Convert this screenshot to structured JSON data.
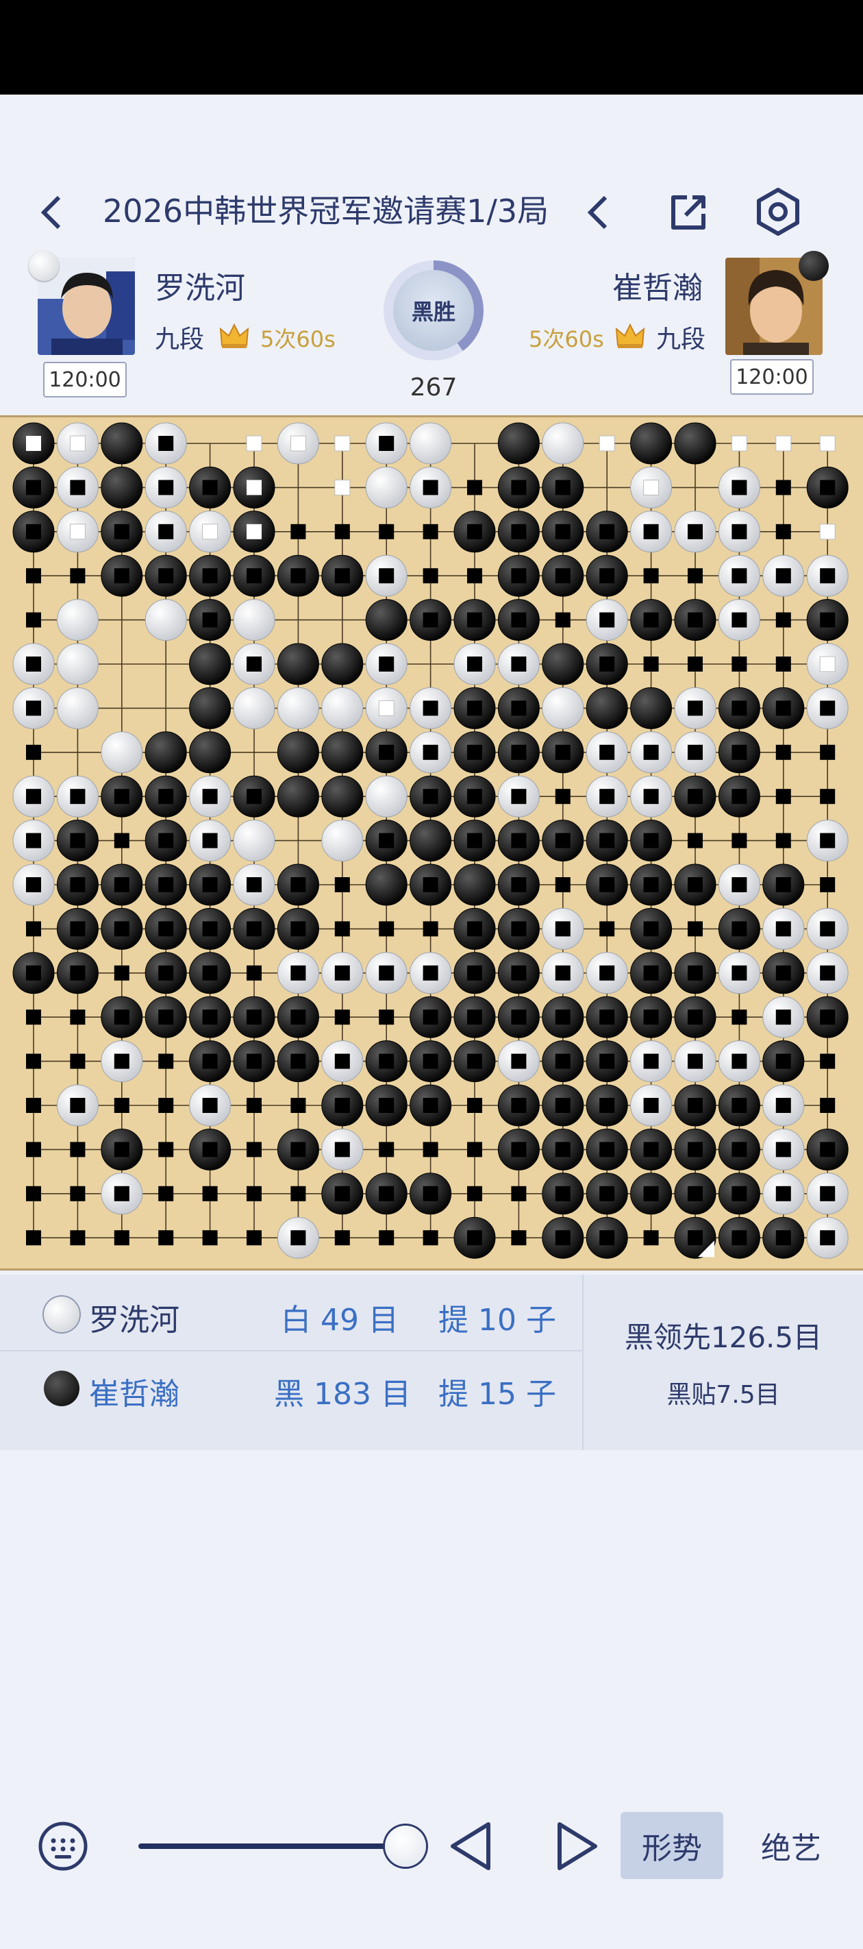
{
  "header": {
    "title": "2026中韩世界冠军邀请赛1/3局"
  },
  "players": {
    "white": {
      "name": "罗洗河",
      "rank": "九段",
      "info": "5次60s",
      "time": "120:00"
    },
    "black": {
      "name": "崔哲瀚",
      "rank": "九段",
      "info": "5次60s",
      "time": "120:00"
    }
  },
  "result": {
    "label": "黑胜",
    "move_count": "267"
  },
  "board": {
    "size": 19,
    "rows": [
      "bwbw..w.ww.bw.bb...",
      "bwbwbb..ww.bb.w.w.b",
      "bwbwwb....bbbbwww..",
      "..bbbbbbw..bbb..www",
      ".w.wbw..bbbb.wbbw.b",
      "ww..bwbbw.wwbb....w",
      "ww..bwwwwwbbwbbwbbw",
      "..wbb.bbbwbbbwwwb..",
      "wwbbwbbbwbbw.wwbb..",
      "wb.bww.wbbbbbbb...w",
      "wbbbbwb.bbbb.bbbwb.",
      ".bbbbbb...bbw.b.bww",
      "bb.bb.wwwwbbwwbbwbw",
      "..bbbbb..bbbbbbb.wb",
      "..w.bbbwbbbwbbwwwb.",
      ".w..w..bbb.bbbwbbw.",
      "..b.b.bw...bbbbbbwb",
      "..w....bbb..bbbbbww",
      "......w...b.bb.bbbw"
    ],
    "markers": [
      "ww.b.wwwb....w..www",
      "bb.bbw.w.bbbb.w.bbb",
      "bwbbwwbbbbbbbbbbbbw",
      "bbbbbbbbbbbbbbbbbbb",
      "b...b....bbbbbbbbbb",
      "b....b..b.bb.bbbbbw",
      "b.......wbbb...bbbb",
      "b.......bbbbbbbbbbb",
      "bbbbbb...bbbbbbbbbb",
      "bbbbb...b.bbbbbbbbb",
      "bbbbbbbb.b.bbbbbbbb",
      "bbbbbbbbbbbbbbbbbbb",
      "bbbbbbbbbbbbbbbbbbb",
      "bbbbbbbbbbbbbbbbbbb",
      "bbbbbbbbbbbbbbbbbbb",
      "bbbbbbbbbbbbbbbbbbb",
      "bbbbbbbbbbbbbbbbbbb",
      "bbbbbbbbbbbbbbbbbbb",
      "bbbbbbbbbbbbbbbbbbb"
    ],
    "last_move": [
      15,
      18
    ]
  },
  "score": {
    "white": {
      "name": "罗洗河",
      "territory": "白 49 目",
      "captures": "提 10 子"
    },
    "black": {
      "name": "崔哲瀚",
      "territory": "黑 183 目",
      "captures": "提 15 子"
    },
    "lead": "黑领先126.5目",
    "komi": "黑贴7.5目"
  },
  "toolbar": {
    "slider_value": 1.0,
    "situation_label": "形势",
    "ai_label": "绝艺"
  },
  "icons": [
    "back-icon",
    "prev-icon",
    "share-icon",
    "settings-icon",
    "keyboard-icon",
    "play-back-icon",
    "play-forward-icon"
  ]
}
